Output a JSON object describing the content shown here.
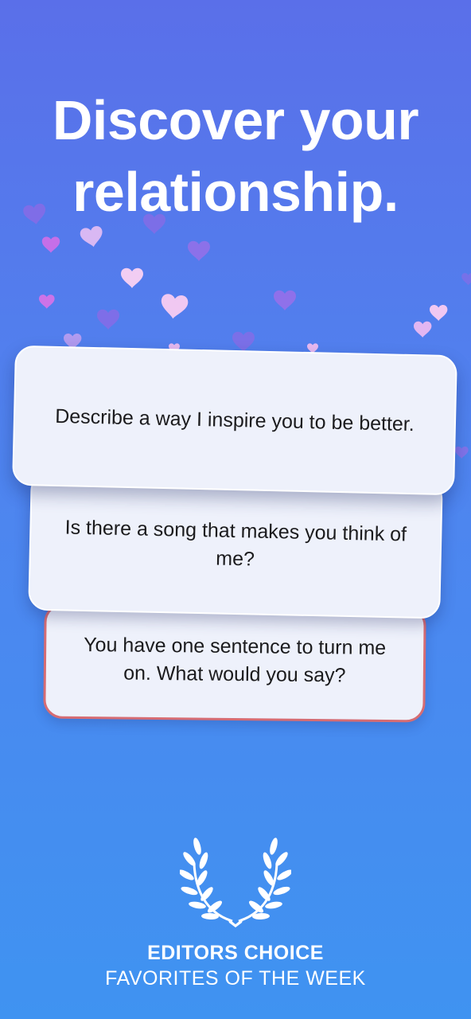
{
  "headline": {
    "line1": "Discover your",
    "line2": "relationship."
  },
  "cards": [
    {
      "text": "Describe a way I inspire you to be better."
    },
    {
      "text": "Is there a song that makes you think of me?"
    },
    {
      "text": "You have one sentence to turn me on. What would you say?"
    }
  ],
  "award": {
    "icon": "laurel-wreath-icon",
    "title": "EDITORS CHOICE",
    "subtitle": "FAVORITES OF THE WEEK"
  },
  "colors": {
    "background_top": "#5a6fe9",
    "background_bottom": "#3f93f1",
    "card": "#eef1fb",
    "card_border_accent": "#d66c73",
    "heart_light": "#f0c8f2",
    "heart_purple": "#9f6fe9"
  }
}
